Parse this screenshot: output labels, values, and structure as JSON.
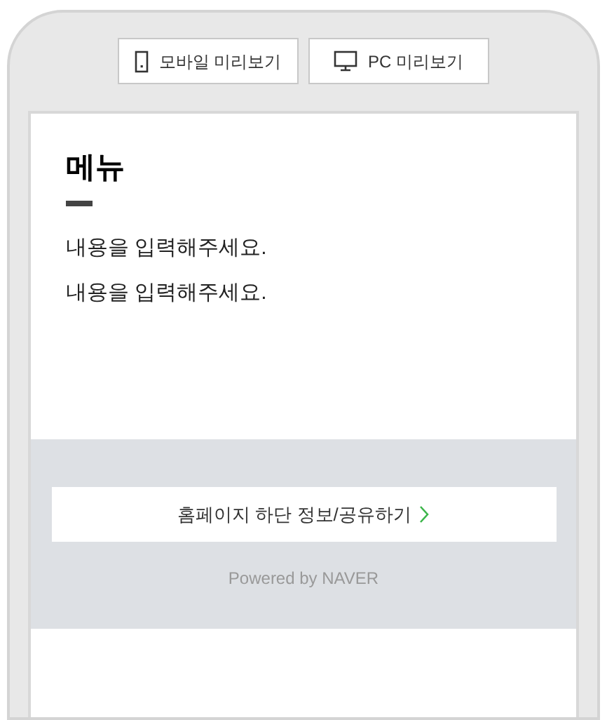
{
  "preview_buttons": [
    {
      "kind": "mobile",
      "label": "모바일 미리보기"
    },
    {
      "kind": "pc",
      "label": "PC 미리보기"
    }
  ],
  "menu": {
    "title": "메뉴",
    "lines": [
      "내용을 입력해주세요.",
      "내용을 입력해주세요."
    ]
  },
  "footer": {
    "info_button": "홈페이지 하단 정보/공유하기",
    "powered": "Powered by NAVER"
  }
}
